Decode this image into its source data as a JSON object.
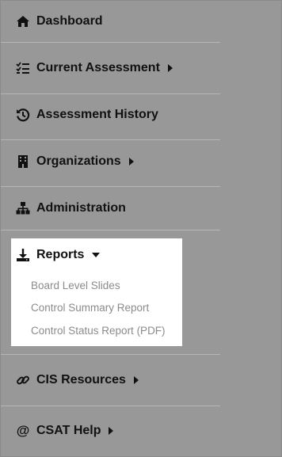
{
  "nav": {
    "dashboard": {
      "label": "Dashboard",
      "icon": "home-icon"
    },
    "current_assessment": {
      "label": "Current Assessment",
      "icon": "list-check-icon"
    },
    "assessment_history": {
      "label": "Assessment History",
      "icon": "history-icon"
    },
    "organizations": {
      "label": "Organizations",
      "icon": "building-icon"
    },
    "administration": {
      "label": "Administration",
      "icon": "sitemap-icon"
    },
    "reports": {
      "label": "Reports",
      "icon": "download-icon",
      "items": [
        {
          "label": "Board Level Slides"
        },
        {
          "label": "Control Summary Report"
        },
        {
          "label": "Control Status Report (PDF)"
        }
      ]
    },
    "cis_resources": {
      "label": "CIS Resources",
      "icon": "link-icon"
    },
    "csat_help": {
      "label": "CSAT Help",
      "icon": "at-icon"
    }
  },
  "colors": {
    "sidebar_bg": "#989898",
    "separator": "#b6b6b6",
    "text": "#111111",
    "submenu_bg": "#ffffff",
    "submenu_text": "#8b8b8b"
  }
}
